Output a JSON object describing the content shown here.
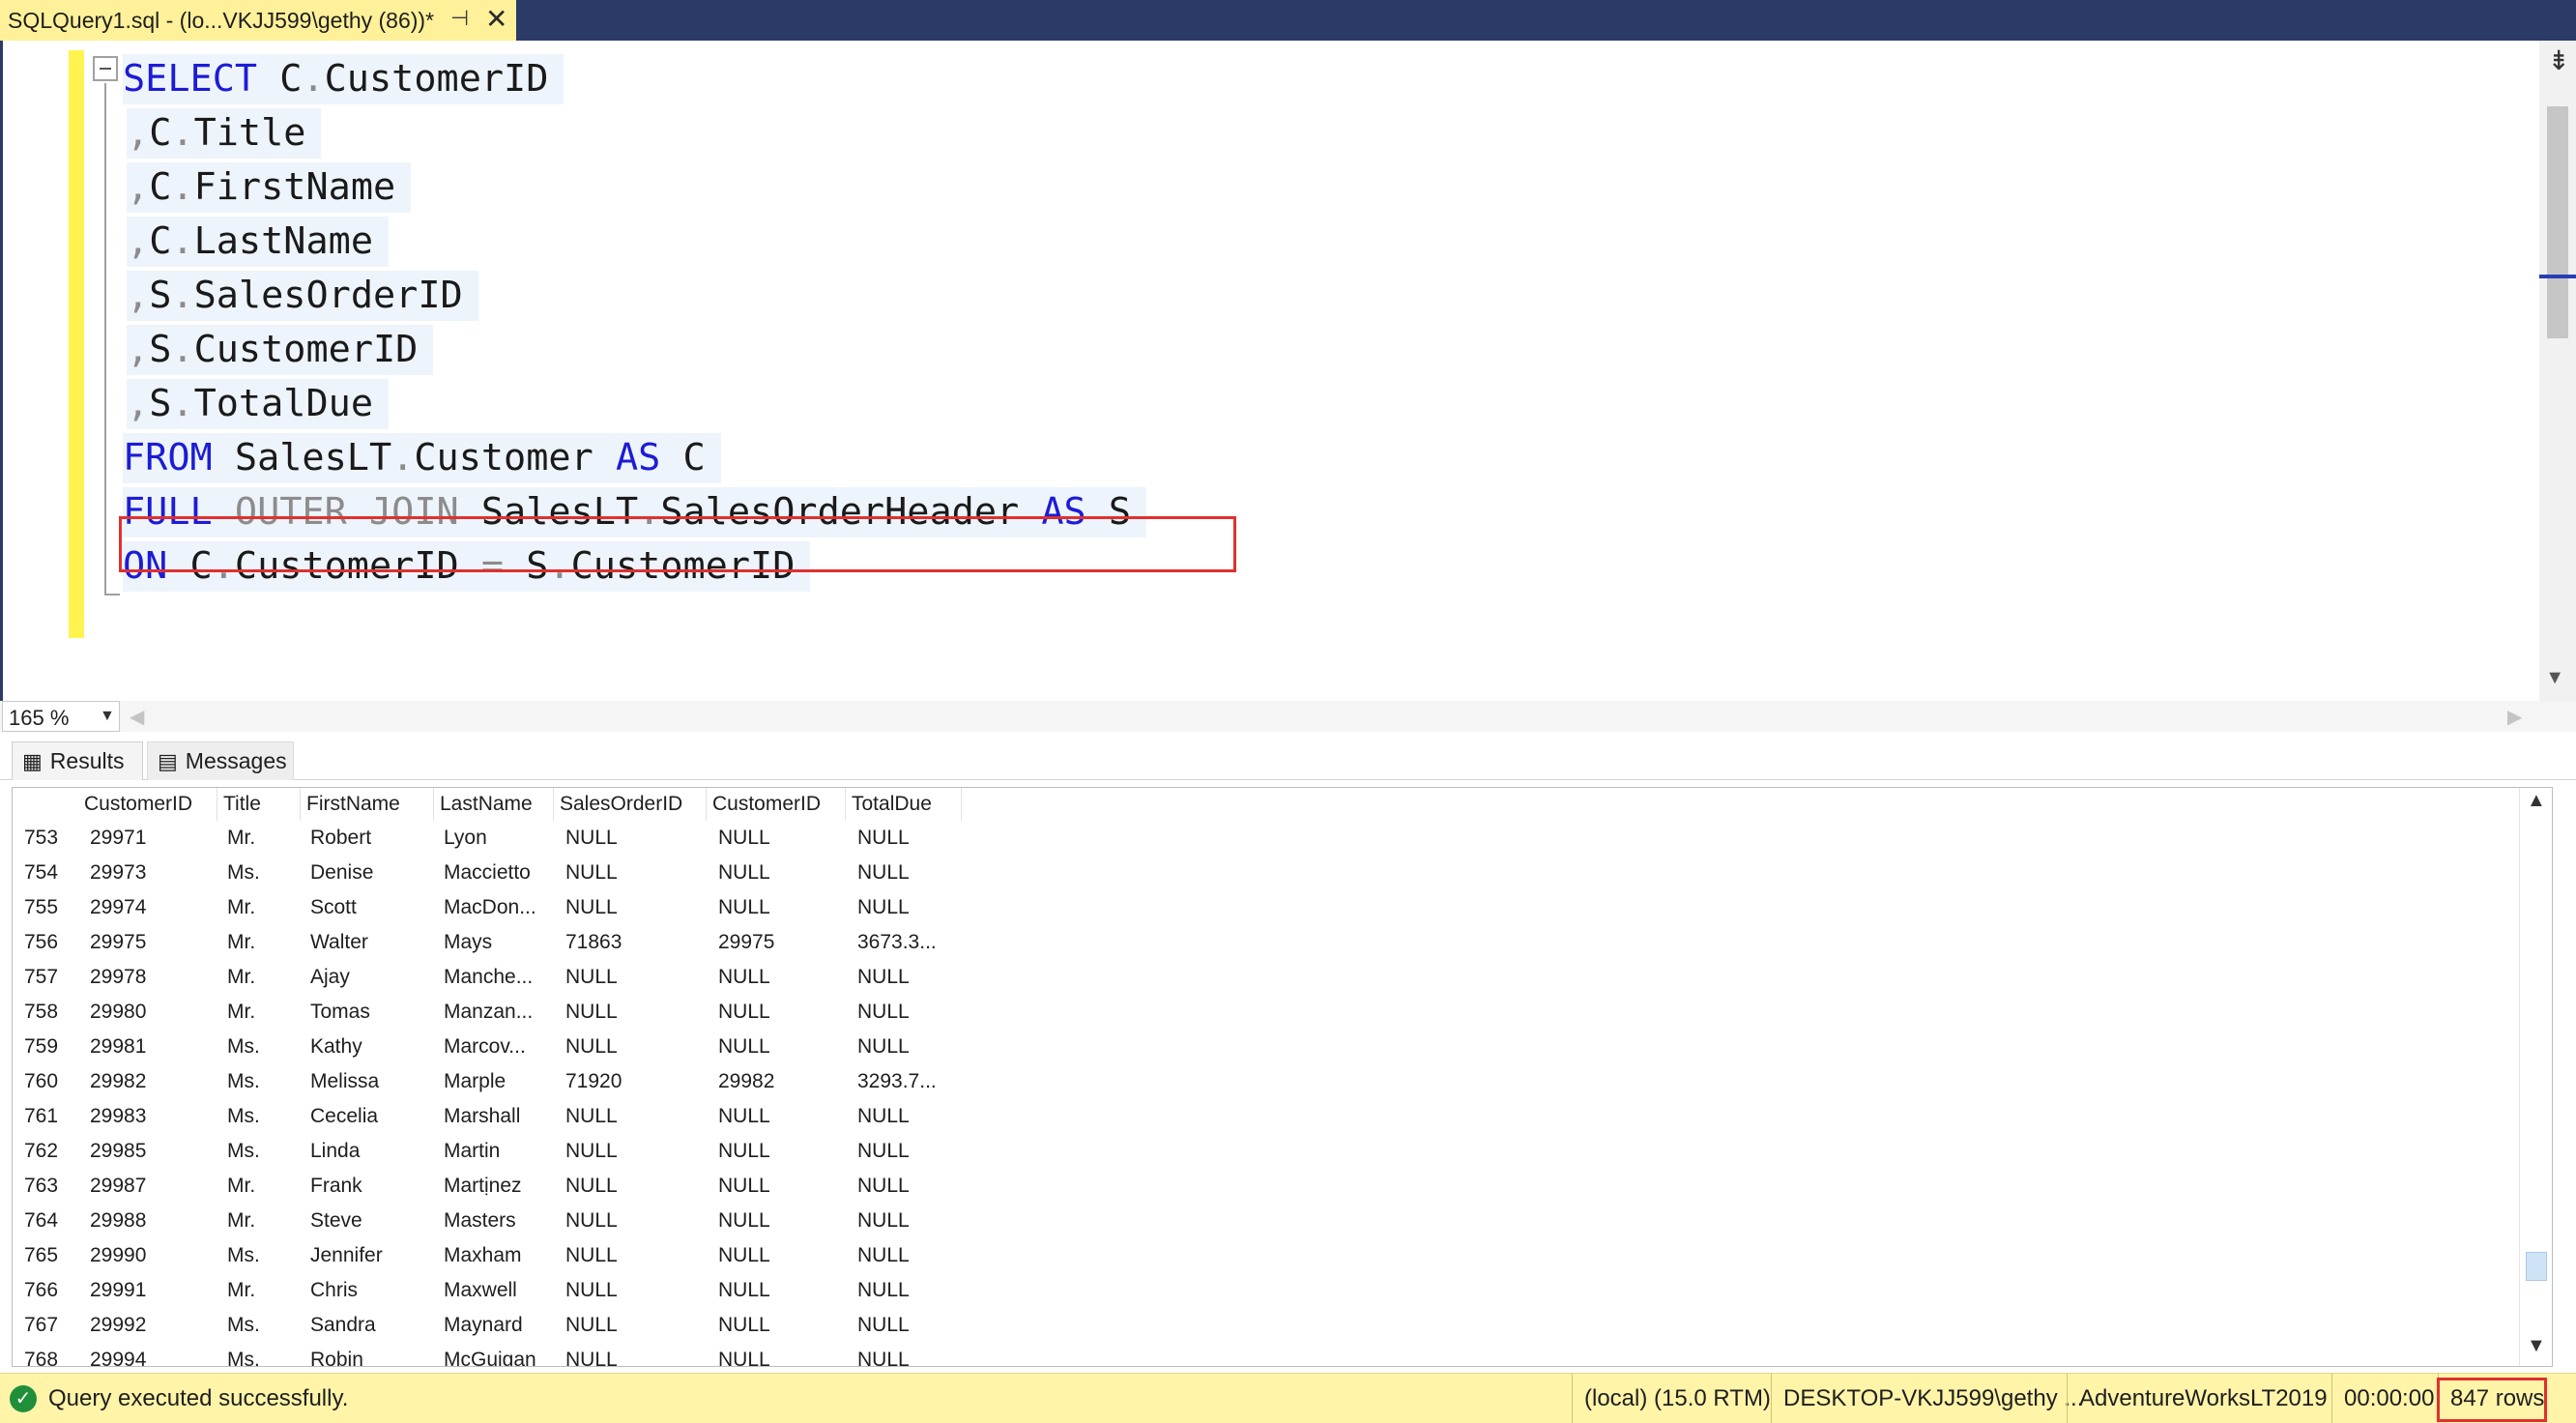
{
  "tab": {
    "title": "SQLQuery1.sql - (lo...VKJJ599\\gethy (86))*",
    "pin_icon": "pin-icon",
    "close_icon": "close-icon"
  },
  "editor": {
    "lines": [
      [
        {
          "t": "SELECT",
          "c": "kw"
        },
        {
          "t": " C",
          "c": ""
        },
        {
          "t": ".",
          "c": "gray"
        },
        {
          "t": "CustomerID",
          "c": ""
        }
      ],
      [
        {
          "t": ",",
          "c": "gray"
        },
        {
          "t": "C",
          "c": ""
        },
        {
          "t": ".",
          "c": "gray"
        },
        {
          "t": "Title",
          "c": ""
        }
      ],
      [
        {
          "t": ",",
          "c": "gray"
        },
        {
          "t": "C",
          "c": ""
        },
        {
          "t": ".",
          "c": "gray"
        },
        {
          "t": "FirstName",
          "c": ""
        }
      ],
      [
        {
          "t": ",",
          "c": "gray"
        },
        {
          "t": "C",
          "c": ""
        },
        {
          "t": ".",
          "c": "gray"
        },
        {
          "t": "LastName",
          "c": ""
        }
      ],
      [
        {
          "t": ",",
          "c": "gray"
        },
        {
          "t": "S",
          "c": ""
        },
        {
          "t": ".",
          "c": "gray"
        },
        {
          "t": "SalesOrderID",
          "c": ""
        }
      ],
      [
        {
          "t": ",",
          "c": "gray"
        },
        {
          "t": "S",
          "c": ""
        },
        {
          "t": ".",
          "c": "gray"
        },
        {
          "t": "CustomerID",
          "c": ""
        }
      ],
      [
        {
          "t": ",",
          "c": "gray"
        },
        {
          "t": "S",
          "c": ""
        },
        {
          "t": ".",
          "c": "gray"
        },
        {
          "t": "TotalDue",
          "c": ""
        }
      ],
      [
        {
          "t": "FROM",
          "c": "kw"
        },
        {
          "t": " SalesLT",
          "c": ""
        },
        {
          "t": ".",
          "c": "gray"
        },
        {
          "t": "Customer ",
          "c": ""
        },
        {
          "t": "AS",
          "c": "kw"
        },
        {
          "t": " C",
          "c": ""
        }
      ],
      [
        {
          "t": "FULL",
          "c": "kw"
        },
        {
          "t": " OUTER JOIN",
          "c": "gray"
        },
        {
          "t": " SalesLT",
          "c": ""
        },
        {
          "t": ".",
          "c": "gray"
        },
        {
          "t": "SalesOrderHeader ",
          "c": ""
        },
        {
          "t": "AS",
          "c": "kw"
        },
        {
          "t": " S",
          "c": ""
        }
      ],
      [
        {
          "t": "ON",
          "c": "kw"
        },
        {
          "t": " C",
          "c": ""
        },
        {
          "t": ".",
          "c": "gray"
        },
        {
          "t": "CustomerID ",
          "c": ""
        },
        {
          "t": "=",
          "c": "gray"
        },
        {
          "t": " S",
          "c": ""
        },
        {
          "t": ".",
          "c": "gray"
        },
        {
          "t": "CustomerID",
          "c": ""
        }
      ]
    ],
    "zoom": "165 %"
  },
  "results_tabs": {
    "results_label": "Results",
    "messages_label": "Messages"
  },
  "grid": {
    "columns": [
      "CustomerID",
      "Title",
      "FirstName",
      "LastName",
      "SalesOrderID",
      "CustomerID",
      "TotalDue"
    ],
    "rows": [
      [
        "753",
        "29971",
        "Mr.",
        "Robert",
        "Lyon",
        "NULL",
        "NULL",
        "NULL"
      ],
      [
        "754",
        "29973",
        "Ms.",
        "Denise",
        "Maccietto",
        "NULL",
        "NULL",
        "NULL"
      ],
      [
        "755",
        "29974",
        "Mr.",
        "Scott",
        "MacDon...",
        "NULL",
        "NULL",
        "NULL"
      ],
      [
        "756",
        "29975",
        "Mr.",
        "Walter",
        "Mays",
        "71863",
        "29975",
        "3673.3..."
      ],
      [
        "757",
        "29978",
        "Mr.",
        "Ajay",
        "Manche...",
        "NULL",
        "NULL",
        "NULL"
      ],
      [
        "758",
        "29980",
        "Mr.",
        "Tomas",
        "Manzan...",
        "NULL",
        "NULL",
        "NULL"
      ],
      [
        "759",
        "29981",
        "Ms.",
        "Kathy",
        "Marcov...",
        "NULL",
        "NULL",
        "NULL"
      ],
      [
        "760",
        "29982",
        "Ms.",
        "Melissa",
        "Marple",
        "71920",
        "29982",
        "3293.7..."
      ],
      [
        "761",
        "29983",
        "Ms.",
        "Cecelia",
        "Marshall",
        "NULL",
        "NULL",
        "NULL"
      ],
      [
        "762",
        "29985",
        "Ms.",
        "Linda",
        "Martin",
        "NULL",
        "NULL",
        "NULL"
      ],
      [
        "763",
        "29987",
        "Mr.",
        "Frank",
        "Martịnez",
        "NULL",
        "NULL",
        "NULL"
      ],
      [
        "764",
        "29988",
        "Mr.",
        "Steve",
        "Masters",
        "NULL",
        "NULL",
        "NULL"
      ],
      [
        "765",
        "29990",
        "Ms.",
        "Jennifer",
        "Maxham",
        "NULL",
        "NULL",
        "NULL"
      ],
      [
        "766",
        "29991",
        "Mr.",
        "Chris",
        "Maxwell",
        "NULL",
        "NULL",
        "NULL"
      ],
      [
        "767",
        "29992",
        "Ms.",
        "Sandra",
        "Maynard",
        "NULL",
        "NULL",
        "NULL"
      ],
      [
        "768",
        "29994",
        "Ms.",
        "Robin",
        "McGuigan",
        "NULL",
        "NULL",
        "NULL"
      ]
    ]
  },
  "status": {
    "message": "Query executed successfully.",
    "server": "(local) (15.0 RTM)",
    "user": "DESKTOP-VKJJ599\\gethy ...",
    "database": "AdventureWorksLT2019",
    "elapsed": "00:00:00",
    "rows": "847 rows",
    "ok_icon": "check-circle-icon"
  },
  "colors": {
    "tab_bar": "#2b3a67",
    "tab_active": "#fff199",
    "keyword": "#1c1cd6",
    "status_bar": "#fff4a8",
    "highlight": "#e03030"
  }
}
